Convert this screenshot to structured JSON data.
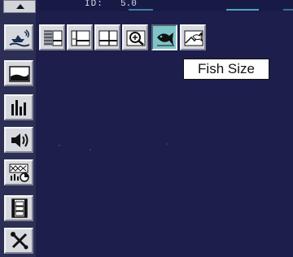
{
  "top_strip": {
    "id_label": "ID:",
    "id_value": "5.0"
  },
  "sidebar": {
    "items": [
      {
        "name": "boat-echo-view-icon"
      },
      {
        "name": "seabed-view-icon"
      },
      {
        "name": "histogram-icon"
      },
      {
        "name": "speaker-icon"
      },
      {
        "name": "mixed-display-icon"
      },
      {
        "name": "film-strip-icon"
      },
      {
        "name": "tools-icon"
      }
    ]
  },
  "toolbar": {
    "buttons": [
      {
        "name": "bottom-lock-icon"
      },
      {
        "name": "zoom-range-icon"
      },
      {
        "name": "range-display-icon"
      },
      {
        "name": "zoom-in-icon"
      },
      {
        "name": "fish-size-icon",
        "active": true
      },
      {
        "name": "fish-symbol-icon"
      }
    ]
  },
  "tooltip": {
    "text": "Fish Size"
  },
  "colors": {
    "display_bg": "#1d1e4c",
    "button_face": "#d7d9de",
    "active_button": "#7fc4c8",
    "tooltip_bg": "#ffffff"
  }
}
